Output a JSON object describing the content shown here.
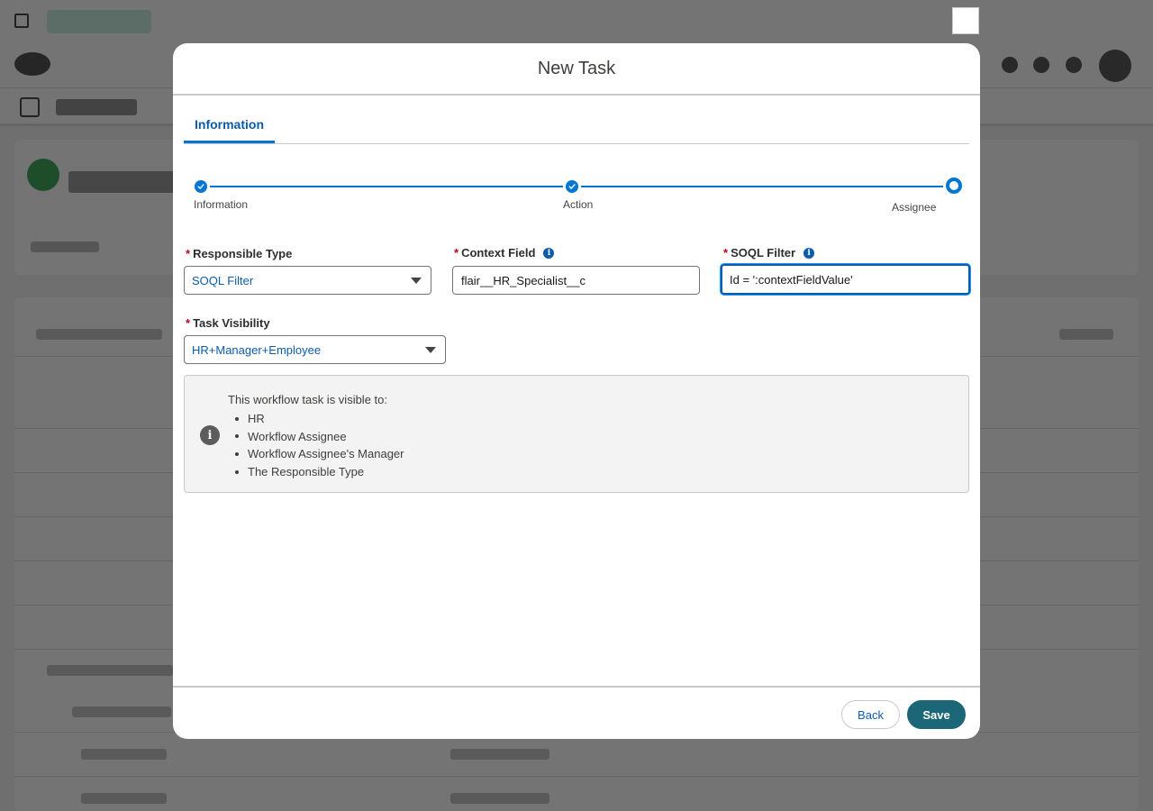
{
  "modal": {
    "title": "New Task"
  },
  "tabs": [
    {
      "label": "Information"
    }
  ],
  "progress": {
    "steps": [
      {
        "label": "Information",
        "state": "complete"
      },
      {
        "label": "Action",
        "state": "complete"
      },
      {
        "label": "Assignee",
        "state": "current"
      }
    ]
  },
  "form": {
    "responsible_type": {
      "label": "Responsible Type",
      "required": true,
      "value": "SOQL Filter"
    },
    "context_field": {
      "label": "Context Field",
      "required": true,
      "value": "flair__HR_Specialist__c",
      "has_info_icon": true
    },
    "soql_filter": {
      "label": "SOQL Filter",
      "required": true,
      "value": "Id = ':contextFieldValue'",
      "has_info_icon": true,
      "focused": true
    },
    "task_visibility": {
      "label": "Task Visibility",
      "required": true,
      "value": "HR+Manager+Employee"
    },
    "required_marker": "*",
    "info_glyph": "i"
  },
  "visibility_info": {
    "heading": "This workflow task is visible to:",
    "items": [
      "HR",
      "Workflow Assignee",
      "Workflow Assignee's Manager",
      "The Responsible Type"
    ]
  },
  "footer": {
    "back_label": "Back",
    "save_label": "Save"
  },
  "colors": {
    "brand_blue": "#0176d3",
    "link_blue": "#0b5cab",
    "save_button": "#1b6777",
    "required_red": "#ba0517"
  }
}
